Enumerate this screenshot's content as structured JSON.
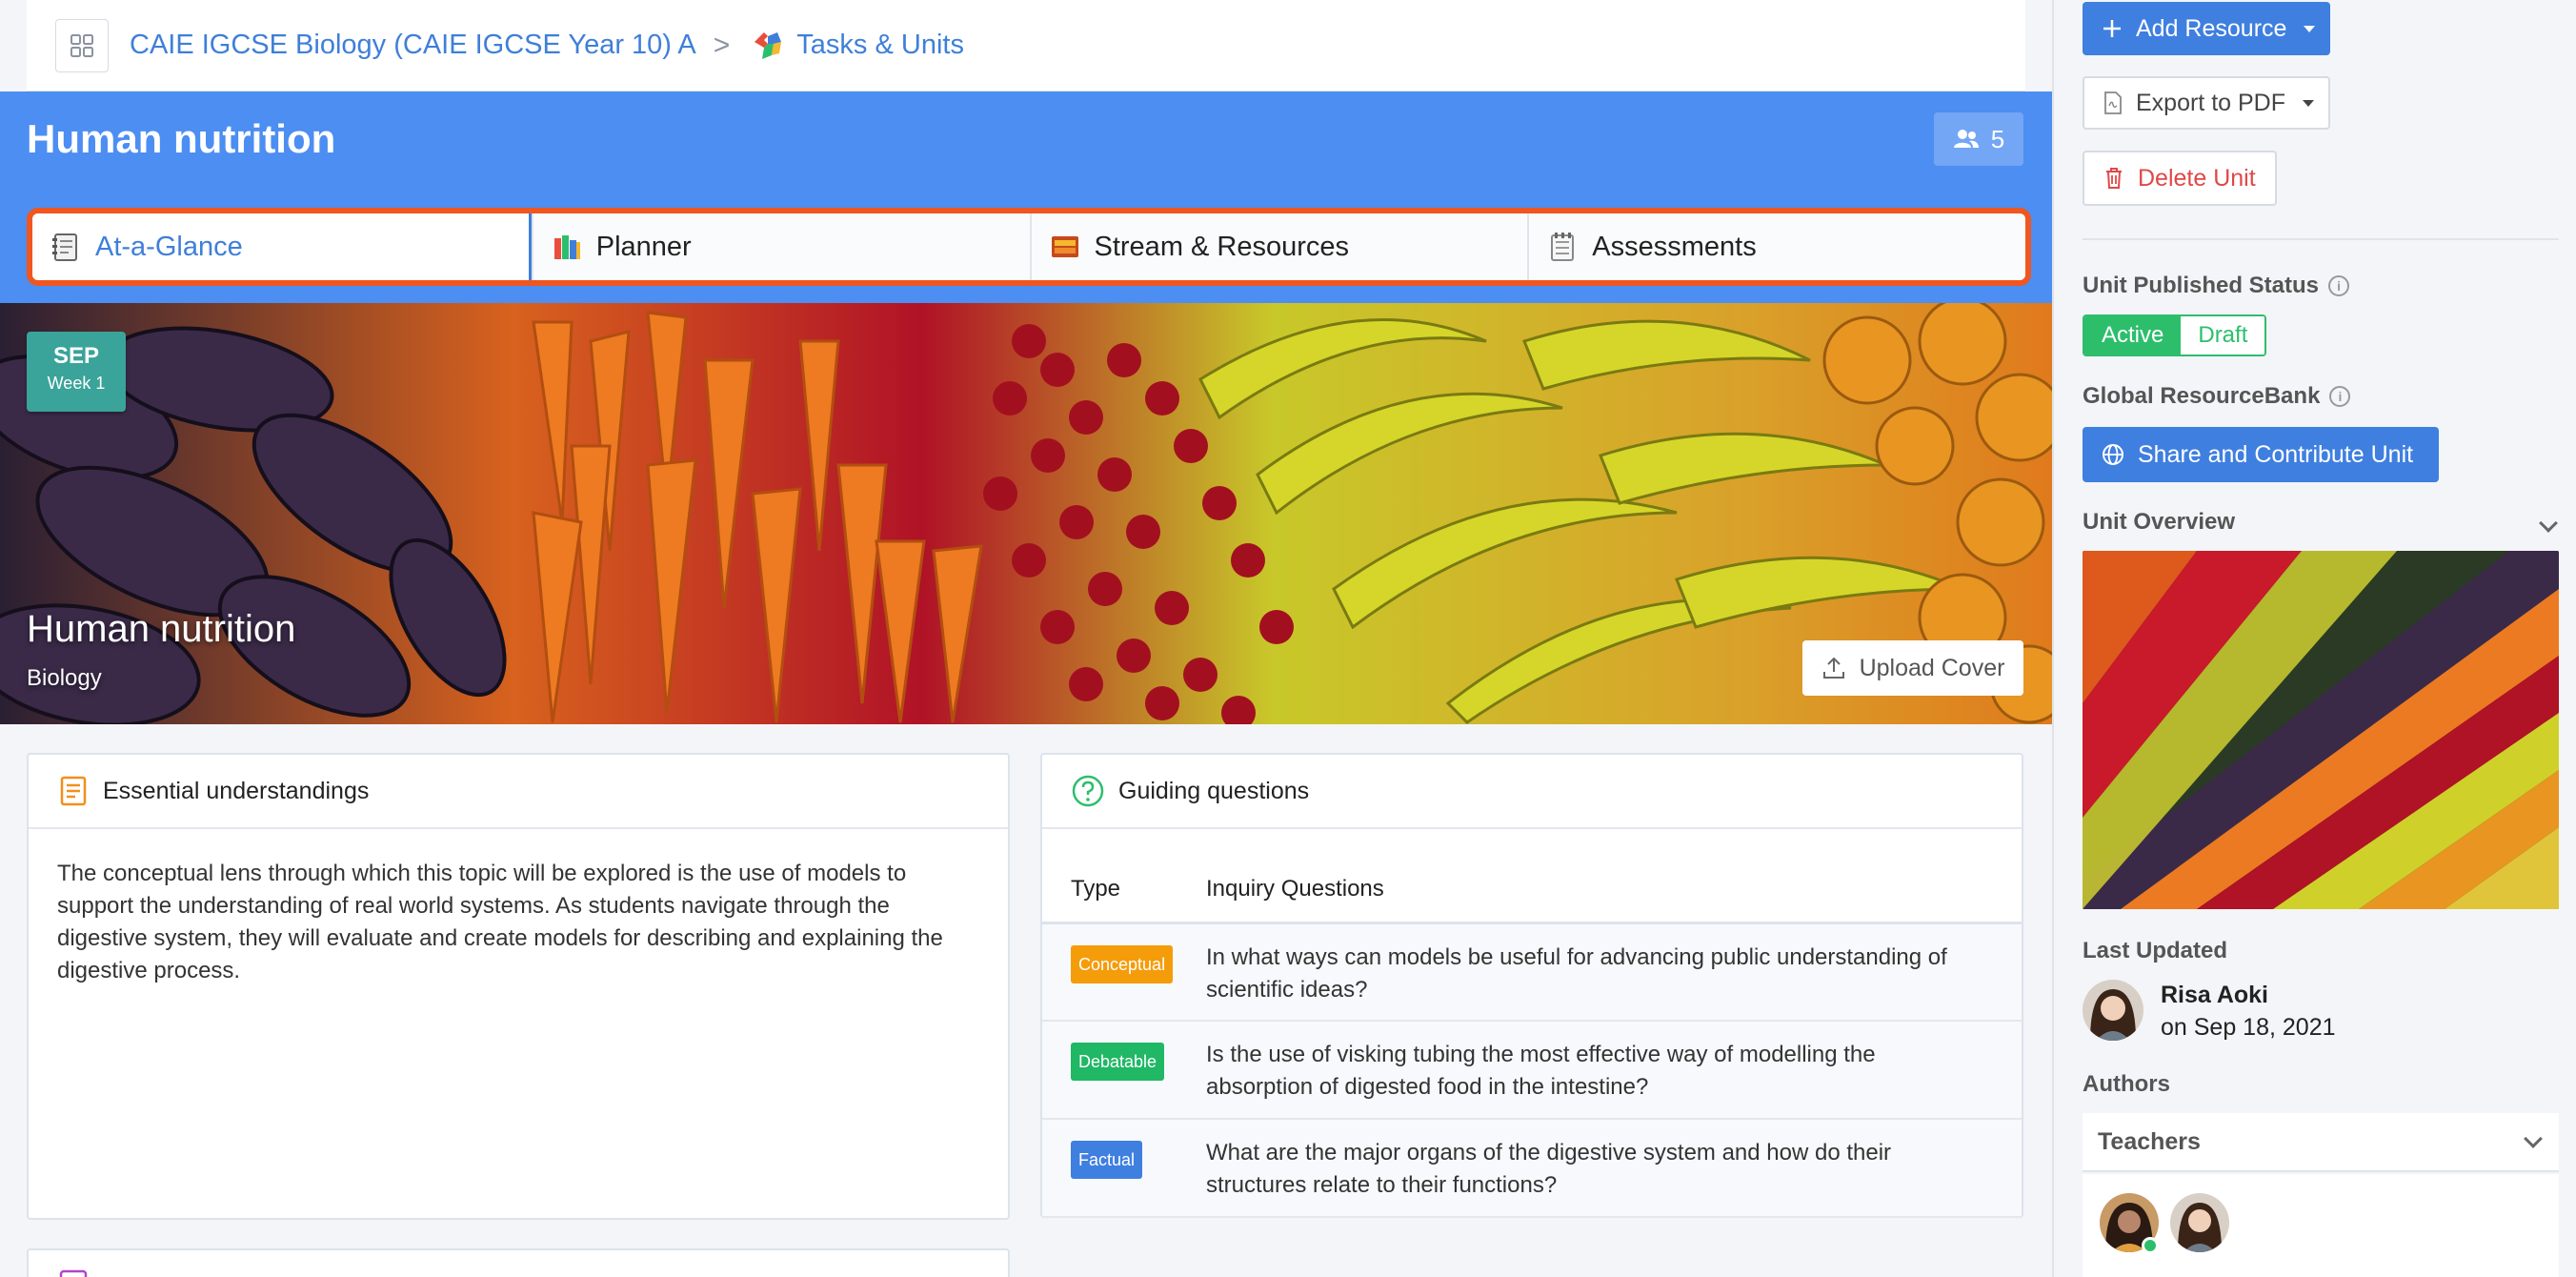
{
  "breadcrumb": {
    "course": "CAIE IGCSE Biology (CAIE IGCSE Year 10) A",
    "separator": ">",
    "section": "Tasks & Units"
  },
  "header": {
    "title": "Human nutrition",
    "member_count": "5"
  },
  "tabs": [
    {
      "label": "At-a-Glance",
      "icon": "notebook-icon",
      "active": true
    },
    {
      "label": "Planner",
      "icon": "books-icon",
      "active": false
    },
    {
      "label": "Stream & Resources",
      "icon": "card-box-icon",
      "active": false
    },
    {
      "label": "Assessments",
      "icon": "notepad-icon",
      "active": false
    }
  ],
  "cover": {
    "month": "SEP",
    "week": "Week 1",
    "title": "Human nutrition",
    "subject": "Biology",
    "upload_label": "Upload Cover"
  },
  "essential": {
    "heading": "Essential understandings",
    "text": "The conceptual lens through which this topic will be explored is the use of models to support the understanding of real world systems. As students navigate through the digestive system, they will evaluate and create models for describing and explaining the digestive process."
  },
  "guiding": {
    "heading": "Guiding questions",
    "col_type": "Type",
    "col_question": "Inquiry Questions",
    "rows": [
      {
        "type": "Conceptual",
        "color": "#f59c0b",
        "question": "In what ways can models be useful for advancing public understanding of scientific ideas?"
      },
      {
        "type": "Debatable",
        "color": "#20b765",
        "question": "Is the use of visking tubing the most effective way of modelling the absorption of digested food in the intestine?"
      },
      {
        "type": "Factual",
        "color": "#3f7fe0",
        "question": "What are the major organs of the digestive system and how do their structures relate to their functions?"
      }
    ]
  },
  "sidebar": {
    "add_resource": "Add Resource",
    "export_pdf": "Export to PDF",
    "delete_unit": "Delete Unit",
    "published_label": "Unit Published Status",
    "status_active": "Active",
    "status_draft": "Draft",
    "resourcebank_label": "Global ResourceBank",
    "share_label": "Share and Contribute Unit",
    "overview_label": "Unit Overview",
    "last_updated_label": "Last Updated",
    "updated_by": "Risa Aoki",
    "updated_on": "on Sep 18, 2021",
    "authors_label": "Authors",
    "teachers_label": "Teachers"
  },
  "colors": {
    "header_blue": "#4c8ef2",
    "tab_highlight": "#f0561f",
    "link_blue": "#3f7fd9",
    "active_green": "#2dbe6c",
    "danger_red": "#e04848"
  }
}
